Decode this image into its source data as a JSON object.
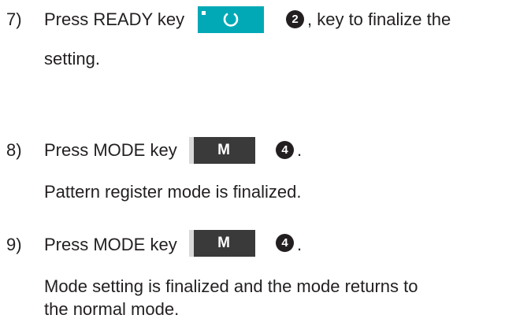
{
  "step7": {
    "number": "7)",
    "text_before": "Press READY key",
    "key_icon": "ready-circle-icon",
    "badge": "2",
    "text_after": ", key to finalize the",
    "continuation": "setting."
  },
  "step8": {
    "number": "8)",
    "text_before": "Press MODE key",
    "key_label": "M",
    "badge": "4",
    "text_after": ".",
    "continuation": "Pattern register mode is finalized."
  },
  "step9": {
    "number": "9)",
    "text_before": "Press MODE key",
    "key_label": "M",
    "badge": "4",
    "text_after": ".",
    "continuation_1": "Mode setting is finalized and the mode returns to",
    "continuation_2": "the normal mode."
  },
  "colors": {
    "ready_key": "#00a9b5",
    "mode_key": "#3a3a3a",
    "text": "#231f20"
  }
}
